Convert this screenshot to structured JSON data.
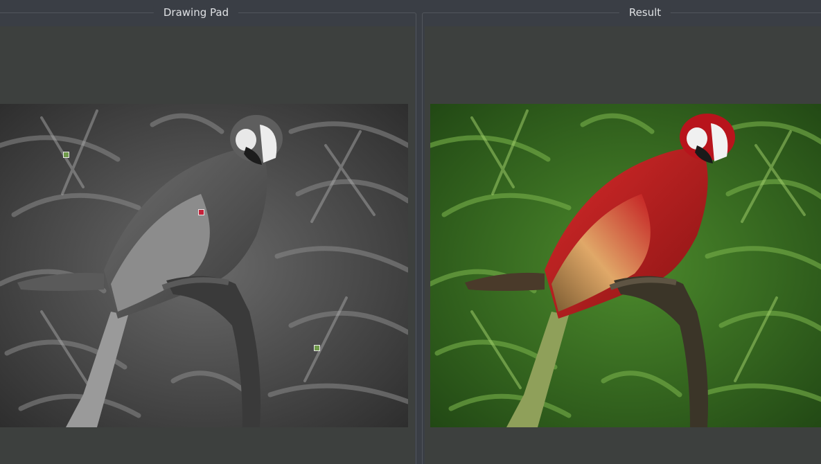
{
  "panels": {
    "drawing_pad": {
      "title": "Drawing Pad"
    },
    "result": {
      "title": "Result"
    }
  },
  "colors": {
    "window_bg": "#3a3e45",
    "view_bg": "#3d403e",
    "title_text": "#dfe1e4",
    "hint_green": "#6f9a4a",
    "hint_red": "#c4233a",
    "parrot_red": "#c81e26",
    "foliage_green": "#3f7d24"
  },
  "color_hints": [
    {
      "name": "green-hint-1",
      "color": "#6f9a4a"
    },
    {
      "name": "red-hint",
      "color": "#c4233a"
    },
    {
      "name": "green-hint-2",
      "color": "#6f9a4a"
    }
  ]
}
